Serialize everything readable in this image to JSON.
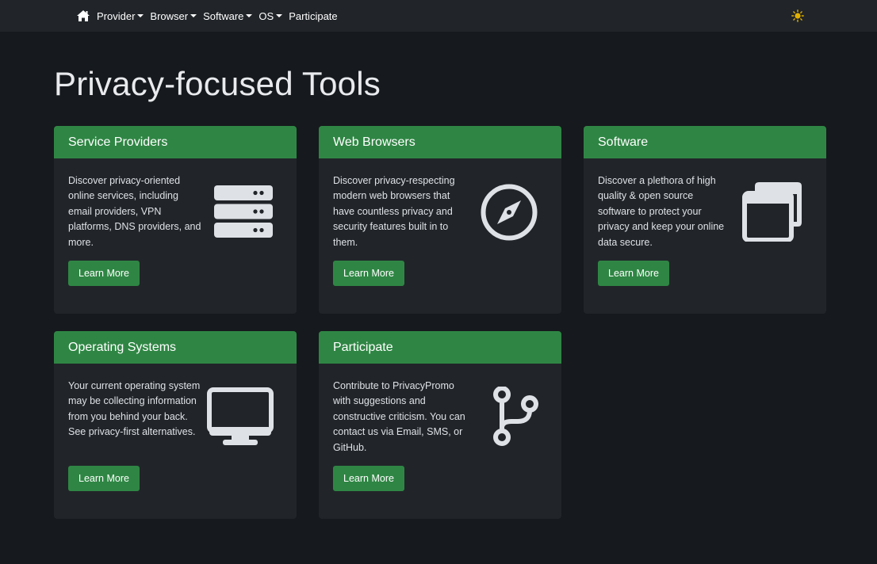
{
  "nav": {
    "home_icon": "home-icon",
    "items": [
      {
        "label": "Provider",
        "dropdown": true
      },
      {
        "label": "Browser",
        "dropdown": true
      },
      {
        "label": "Software",
        "dropdown": true
      },
      {
        "label": "OS",
        "dropdown": true
      },
      {
        "label": "Participate",
        "dropdown": false
      }
    ],
    "theme_icon": "sun-icon"
  },
  "page": {
    "title": "Privacy-focused Tools"
  },
  "cards": [
    {
      "title": "Service Providers",
      "text": "Discover privacy-oriented online services, including email providers, VPN platforms, DNS providers, and more.",
      "button": "Learn More",
      "icon": "server-icon"
    },
    {
      "title": "Web Browsers",
      "text": "Discover privacy-respecting modern web browsers that have countless privacy and security features built in to them.",
      "button": "Learn More",
      "icon": "compass-icon"
    },
    {
      "title": "Software",
      "text": "Discover a plethora of high quality & open source software to protect your privacy and keep your online data secure.",
      "button": "Learn More",
      "icon": "windows-icon"
    },
    {
      "title": "Operating Systems",
      "text": "Your current operating system may be collecting information from you behind your back. See privacy-first alternatives.",
      "button": "Learn More",
      "icon": "desktop-icon"
    },
    {
      "title": "Participate",
      "text": "Contribute to PrivacyPromo with suggestions and constructive criticism. You can contact us via Email, SMS, or GitHub.",
      "button": "Learn More",
      "icon": "code-branch-icon"
    }
  ],
  "colors": {
    "accent": "#2f8644",
    "background": "#16191d",
    "card": "#212529",
    "navbar": "#212529",
    "icon": "#dee2e6",
    "sun": "#e0b000"
  }
}
